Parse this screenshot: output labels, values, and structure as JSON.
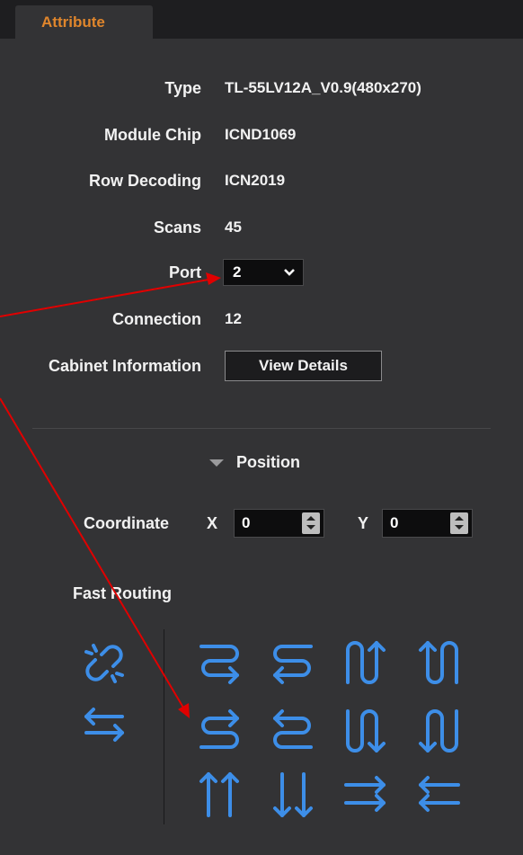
{
  "tab": {
    "label": "Attribute"
  },
  "attributes": {
    "type": {
      "label": "Type",
      "value": "TL-55LV12A_V0.9(480x270)"
    },
    "module_chip": {
      "label": "Module Chip",
      "value": "ICND1069"
    },
    "row_decoding": {
      "label": "Row Decoding",
      "value": "ICN2019"
    },
    "scans": {
      "label": "Scans",
      "value": "45"
    },
    "port": {
      "label": "Port",
      "value": "2"
    },
    "connection": {
      "label": "Connection",
      "value": "12"
    },
    "cabinet": {
      "label": "Cabinet Information",
      "button": "View Details"
    }
  },
  "position": {
    "heading": "Position",
    "coordinate_label": "Coordinate",
    "x_label": "X",
    "x_value": "0",
    "y_label": "Y",
    "y_value": "0"
  },
  "fast_routing": {
    "label": "Fast Routing",
    "icons": [
      "unlink-icon",
      "swap-horizontal-icon",
      "snake-right-down-icon",
      "snake-left-down-icon",
      "snake-up-right-icon",
      "snake-up-left-icon",
      "snake-right-up-icon",
      "snake-left-up-icon",
      "snake-down-right-icon",
      "snake-down-left-icon",
      "parallel-up-icon",
      "parallel-down-icon",
      "parallel-right-icon",
      "parallel-left-icon"
    ]
  },
  "colors": {
    "accent": "#e0862c",
    "routing_icon": "#3d8ee8",
    "annotation_arrow": "#e00000"
  }
}
